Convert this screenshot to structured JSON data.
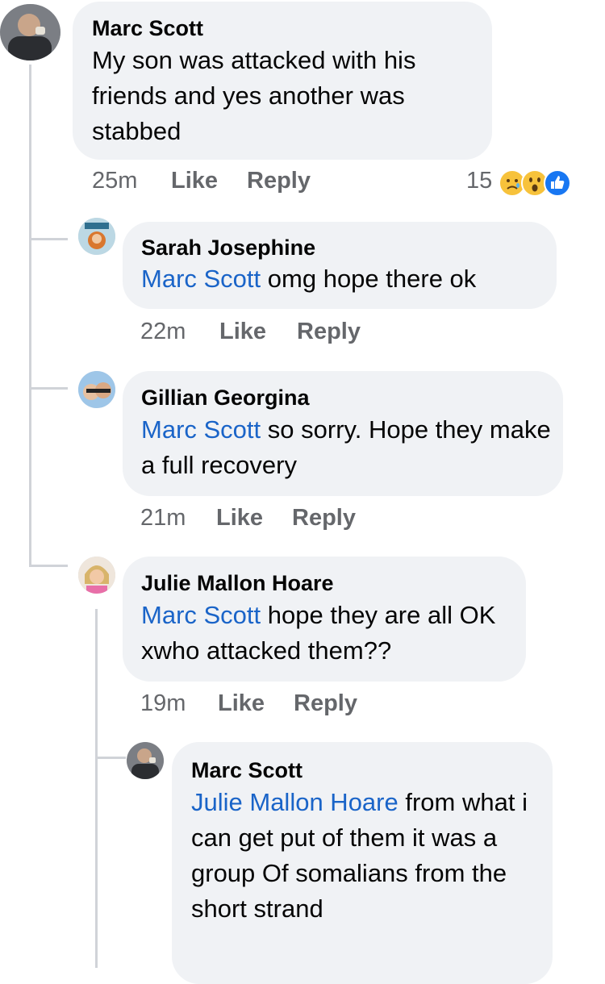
{
  "comments": [
    {
      "name": "Marc Scott",
      "mention": "",
      "text": "My son was attacked with his friends and yes another was stabbed",
      "time": "25m",
      "like": "Like",
      "reply": "Reply",
      "reaction_count": "15",
      "reaction_icons": [
        "sad-face-icon",
        "wow-face-icon",
        "like-thumb-icon"
      ]
    },
    {
      "name": "Sarah Josephine",
      "mention": "Marc Scott",
      "text": "omg hope there ok",
      "time": "22m",
      "like": "Like",
      "reply": "Reply"
    },
    {
      "name": "Gillian Georgina",
      "mention": "Marc Scott",
      "text": "so sorry. Hope they make a full recovery",
      "time": "21m",
      "like": "Like",
      "reply": "Reply"
    },
    {
      "name": "Julie Mallon Hoare",
      "mention": "Marc Scott",
      "text": "hope they are all OK xwho attacked them??",
      "time": "19m",
      "like": "Like",
      "reply": "Reply"
    },
    {
      "name": "Marc Scott",
      "mention": "Julie Mallon Hoare",
      "text": "from what i can get put of them it was a group Of somalians from the short strand"
    }
  ],
  "colors": {
    "bubble": "#f0f2f5",
    "mention": "#1a64c8",
    "meta": "#65676b",
    "thread_line": "#d0d3d8"
  }
}
